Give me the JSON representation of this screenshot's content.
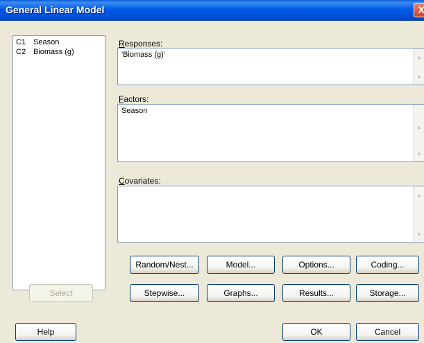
{
  "window": {
    "title": "General Linear Model",
    "close_glyph": "X"
  },
  "variables": [
    {
      "id": "C1",
      "name": "Season"
    },
    {
      "id": "C2",
      "name": "Biomass (g)"
    }
  ],
  "responses": {
    "label_mnemonic": "R",
    "label_rest": "esponses:",
    "value": "'Biomass (g)'"
  },
  "factors": {
    "label_mnemonic": "F",
    "label_rest": "actors:",
    "value": "Season"
  },
  "covariates": {
    "label_mnemonic": "C",
    "label_rest": "ovariates:",
    "value": ""
  },
  "buttons": {
    "random_nest": "Random/Nest...",
    "model": "Model...",
    "options": "Options...",
    "coding": "Coding...",
    "select": "Select",
    "stepwise": "Stepwise...",
    "graphs": "Graphs...",
    "results": "Results...",
    "storage": "Storage...",
    "help": "Help",
    "ok": "OK",
    "cancel": "Cancel"
  },
  "icons": {
    "scroll_up": "chevron-up-icon",
    "scroll_down": "chevron-down-icon"
  }
}
